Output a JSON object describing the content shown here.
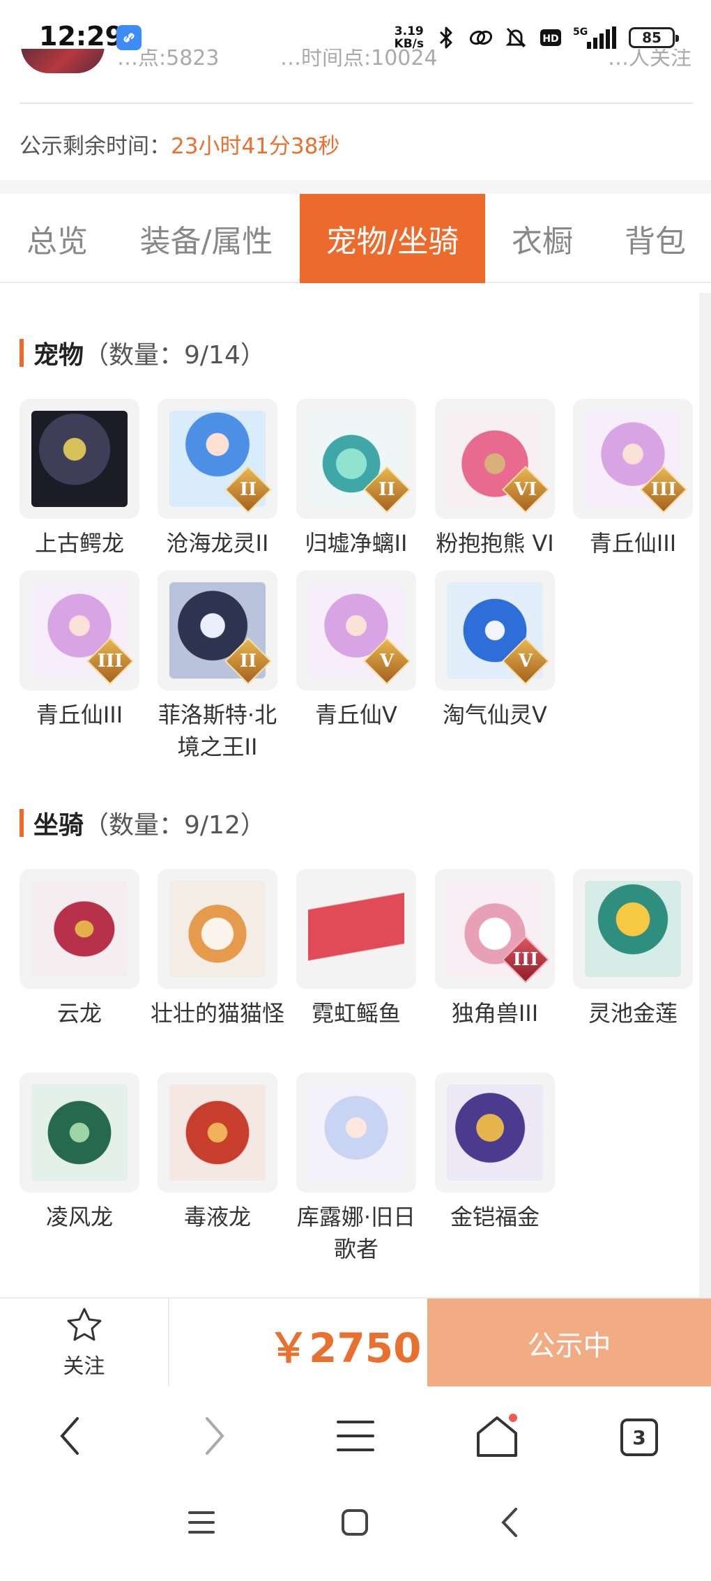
{
  "status_bar": {
    "time": "12:29",
    "net_speed_value": "3.19",
    "net_speed_unit": "KB/s",
    "battery": "85",
    "icons": [
      "app-link-icon",
      "bluetooth-icon",
      "link-icon",
      "mute-bell-icon",
      "hd-icon",
      "5g-signal-icon",
      "battery-icon"
    ]
  },
  "header_partial": {
    "left_stat": "…点:5823",
    "mid_stat": "…时间点:10024",
    "right_stat": "…人关注"
  },
  "publicity": {
    "label": "公示剩余时间：",
    "value": "23小时41分38秒"
  },
  "tabs": [
    {
      "label": "总览",
      "active": false
    },
    {
      "label": "装备/属性",
      "active": false
    },
    {
      "label": "宠物/坐骑",
      "active": true
    },
    {
      "label": "衣橱",
      "active": false
    },
    {
      "label": "背包",
      "active": false
    }
  ],
  "pets": {
    "title": "宠物",
    "count": "（数量：9/14）",
    "items": [
      {
        "name": "上古鳄龙",
        "grade": ""
      },
      {
        "name": "沧海龙灵II",
        "grade": "II"
      },
      {
        "name": "归墟净螭II",
        "grade": "II"
      },
      {
        "name": "粉抱抱熊 VI",
        "grade": "VI"
      },
      {
        "name": "青丘仙III",
        "grade": "III"
      },
      {
        "name": "青丘仙III",
        "grade": "III"
      },
      {
        "name": "菲洛斯特·北境之王II",
        "grade": "II"
      },
      {
        "name": "青丘仙V",
        "grade": "V"
      },
      {
        "name": "淘气仙灵V",
        "grade": "V"
      }
    ]
  },
  "mounts": {
    "title": "坐骑",
    "count": "（数量：9/12）",
    "items": [
      {
        "name": "云龙",
        "grade": ""
      },
      {
        "name": "壮壮的猫猫怪",
        "grade": ""
      },
      {
        "name": "霓虹鳐鱼",
        "grade": ""
      },
      {
        "name": "独角兽III",
        "grade": "III"
      },
      {
        "name": "灵池金莲",
        "grade": ""
      },
      {
        "name": "凌风龙",
        "grade": ""
      },
      {
        "name": "毒液龙",
        "grade": ""
      },
      {
        "name": "库露娜·旧日歌者",
        "grade": ""
      },
      {
        "name": "金铠福金",
        "grade": ""
      }
    ]
  },
  "action_bar": {
    "follow_label": "关注",
    "price": "￥2750",
    "status_label": "公示中"
  },
  "browser_nav": {
    "tab_count": "3"
  },
  "colors": {
    "accent": "#ec6a2c",
    "price": "#e8712f",
    "status_button": "#f2ac84"
  }
}
